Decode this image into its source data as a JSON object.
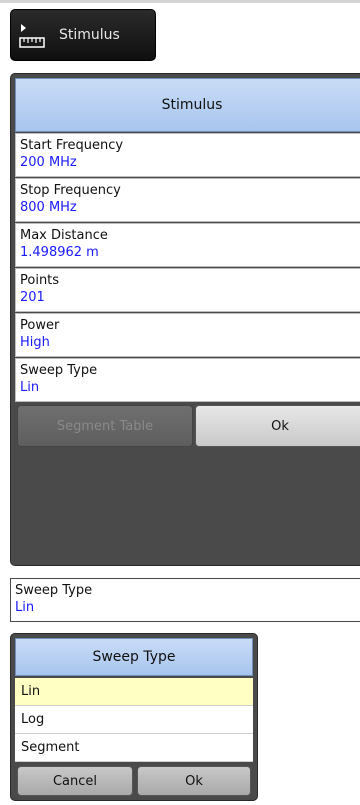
{
  "tab": {
    "label": "Stimulus",
    "icon": "ruler-icon"
  },
  "dialog": {
    "title": "Stimulus",
    "fields": [
      {
        "label": "Start Frequency",
        "value": "200 MHz"
      },
      {
        "label": "Stop Frequency",
        "value": "800 MHz"
      },
      {
        "label": "Max Distance",
        "value": "1.498962 m"
      },
      {
        "label": "Points",
        "value": "201"
      },
      {
        "label": "Power",
        "value": "High"
      },
      {
        "label": "Sweep Type",
        "value": "Lin"
      }
    ],
    "segment_table_label": "Segment Table",
    "ok_label": "Ok"
  },
  "sweep_field": {
    "label": "Sweep Type",
    "value": "Lin"
  },
  "popup": {
    "title": "Sweep Type",
    "options": [
      "Lin",
      "Log",
      "Segment"
    ],
    "selected": "Lin",
    "cancel_label": "Cancel",
    "ok_label": "Ok"
  },
  "colors": {
    "header": "#b8d1f3",
    "value_text": "#1a1aff",
    "selected_option": "#ffffc4",
    "dialog_frame": "#4a4a4a"
  }
}
